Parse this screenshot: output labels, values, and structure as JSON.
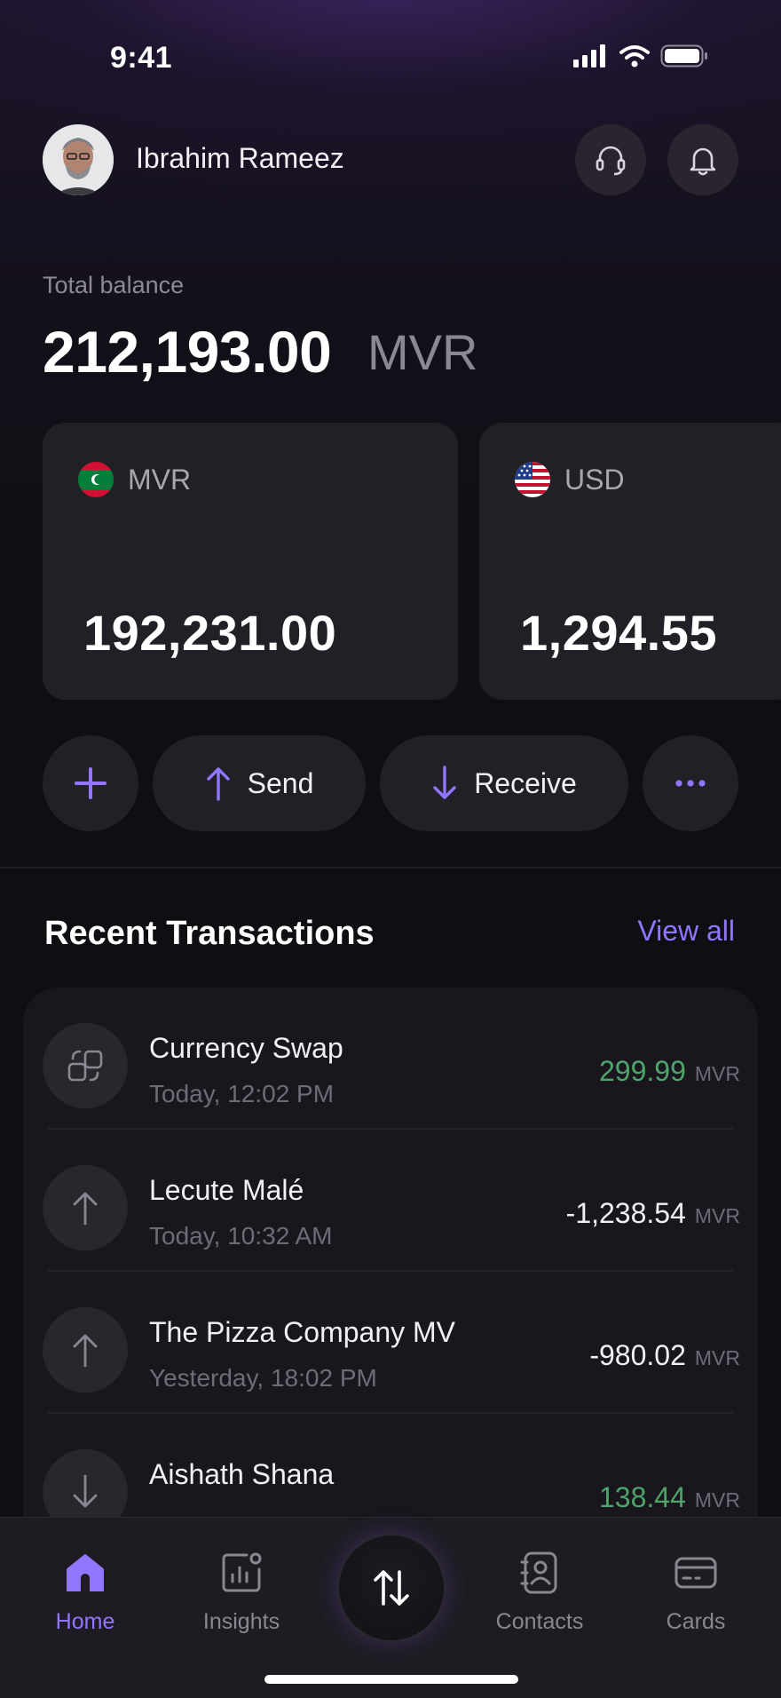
{
  "status_bar": {
    "time": "9:41"
  },
  "header": {
    "user_name": "Ibrahim Rameez"
  },
  "balance": {
    "label": "Total balance",
    "amount": "212,193.00",
    "currency": "MVR"
  },
  "wallets": [
    {
      "code": "MVR",
      "amount": "192,231.00",
      "flag": "maldives-flag"
    },
    {
      "code": "USD",
      "amount": "1,294.55",
      "flag": "us-flag"
    }
  ],
  "actions": {
    "send_label": "Send",
    "receive_label": "Receive"
  },
  "recent": {
    "title": "Recent Transactions",
    "view_all": "View all",
    "items": [
      {
        "name": "Currency Swap",
        "time": "Today, 12:02 PM",
        "amount": "299.99",
        "currency": "MVR",
        "type": "swap",
        "color": "#4ea56b"
      },
      {
        "name": "Lecute Malé",
        "time": "Today, 10:32 AM",
        "amount": "-1,238.54",
        "currency": "MVR",
        "type": "sent",
        "color": "#f2f0f5"
      },
      {
        "name": "The Pizza Company MV",
        "time": "Yesterday, 18:02 PM",
        "amount": "-980.02",
        "currency": "MVR",
        "type": "sent",
        "color": "#f2f0f5"
      },
      {
        "name": "Aishath Shana",
        "time": "",
        "amount": "138.44",
        "currency": "MVR",
        "type": "received",
        "color": "#4ea56b"
      }
    ]
  },
  "nav": {
    "home": "Home",
    "insights": "Insights",
    "contacts": "Contacts",
    "cards": "Cards"
  },
  "colors": {
    "accent": "#9276ff",
    "positive": "#4ea56b"
  }
}
